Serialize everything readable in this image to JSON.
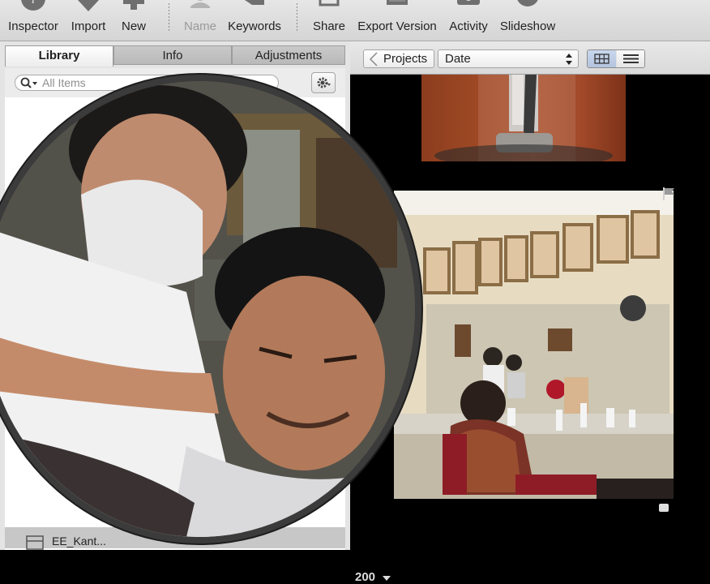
{
  "toolbar": {
    "inspector": "Inspector",
    "import": "Import",
    "new": "New",
    "name": "Name",
    "keywords": "Keywords",
    "share": "Share",
    "export_version": "Export Version",
    "activity": "Activity",
    "slideshow": "Slideshow"
  },
  "tabs": {
    "library": "Library",
    "info": "Info",
    "adjustments": "Adjustments"
  },
  "search": {
    "placeholder": "All Items"
  },
  "library_items": [
    "EE_Kant..."
  ],
  "footer": {
    "count": "200"
  },
  "browser": {
    "projects_label": "Projects",
    "sort_value": "Date"
  },
  "colors": {
    "toolbar_bg": "#dcdcdc",
    "panel_bg": "#e4e4e4",
    "browser_bg": "#000000",
    "selection": "#c7c7c7"
  }
}
